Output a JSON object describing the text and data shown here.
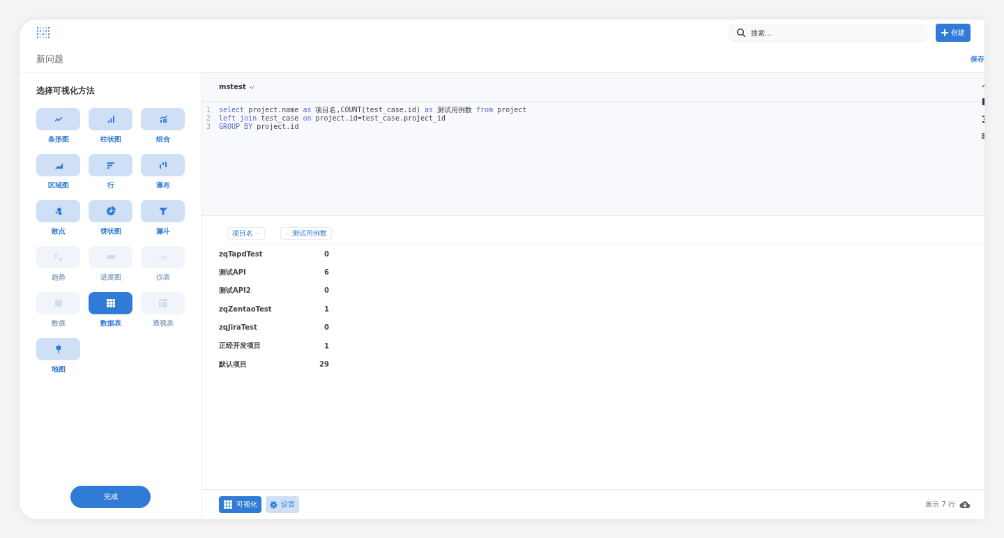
{
  "topbar": {
    "search": {
      "placeholder": "搜索..."
    },
    "create_button": "创建"
  },
  "header": {
    "title": "新问题",
    "save": "保存"
  },
  "sidebar": {
    "heading": "选择可视化方法",
    "done_button": "完成",
    "items": [
      {
        "label": "条形图",
        "kind": "line",
        "disabled": false,
        "selected": false
      },
      {
        "label": "柱状图",
        "kind": "bar",
        "disabled": false,
        "selected": false
      },
      {
        "label": "组合",
        "kind": "combo",
        "disabled": false,
        "selected": false
      },
      {
        "label": "区域图",
        "kind": "area",
        "disabled": false,
        "selected": false
      },
      {
        "label": "行",
        "kind": "row",
        "disabled": false,
        "selected": false
      },
      {
        "label": "瀑布",
        "kind": "waterfall",
        "disabled": false,
        "selected": false
      },
      {
        "label": "散点",
        "kind": "scatter",
        "disabled": false,
        "selected": false
      },
      {
        "label": "饼状图",
        "kind": "pie",
        "disabled": false,
        "selected": false
      },
      {
        "label": "漏斗",
        "kind": "funnel",
        "disabled": false,
        "selected": false
      },
      {
        "label": "趋势",
        "kind": "trend",
        "disabled": true,
        "selected": false
      },
      {
        "label": "进度图",
        "kind": "progress",
        "disabled": true,
        "selected": false
      },
      {
        "label": "仪表",
        "kind": "gauge",
        "disabled": true,
        "selected": false
      },
      {
        "label": "数值",
        "kind": "number",
        "disabled": true,
        "selected": false
      },
      {
        "label": "数据表",
        "kind": "table",
        "disabled": false,
        "selected": true
      },
      {
        "label": "透视表",
        "kind": "pivot",
        "disabled": true,
        "selected": false
      },
      {
        "label": "地图",
        "kind": "map",
        "disabled": false,
        "selected": false
      }
    ]
  },
  "editor": {
    "database": "mstest",
    "lines": [
      {
        "number": "1",
        "tokens": [
          {
            "kind": "keyword",
            "text": "select"
          },
          {
            "kind": "plain",
            "text": " project.name "
          },
          {
            "kind": "keyword",
            "text": "as"
          },
          {
            "kind": "plain",
            "text": " 项目名,COUNT(test_case.id) "
          },
          {
            "kind": "keyword",
            "text": "as"
          },
          {
            "kind": "plain",
            "text": " 测试用例数 "
          },
          {
            "kind": "keyword",
            "text": "from"
          },
          {
            "kind": "plain",
            "text": " project"
          }
        ]
      },
      {
        "number": "2",
        "tokens": [
          {
            "kind": "keyword",
            "text": "left join"
          },
          {
            "kind": "plain",
            "text": " test_case "
          },
          {
            "kind": "keyword",
            "text": "on"
          },
          {
            "kind": "plain",
            "text": " project.id=test_case.project_id"
          }
        ]
      },
      {
        "number": "3",
        "tokens": [
          {
            "kind": "keyword",
            "text": "GROUP BY"
          },
          {
            "kind": "plain",
            "text": " project.id"
          }
        ]
      }
    ]
  },
  "table": {
    "columns": [
      "项目名",
      "测试用例数"
    ],
    "rows": [
      [
        "zqTapdTest",
        "0"
      ],
      [
        "测试API",
        "6"
      ],
      [
        "测试API2",
        "0"
      ],
      [
        "zqZentaoTest",
        "1"
      ],
      [
        "zqJiraTest",
        "0"
      ],
      [
        "正经开发项目",
        "1"
      ],
      [
        "默认项目",
        "29"
      ]
    ]
  },
  "footer": {
    "visualize_button": "可视化",
    "settings_button": "设置",
    "row_count": "展示 7 行"
  }
}
